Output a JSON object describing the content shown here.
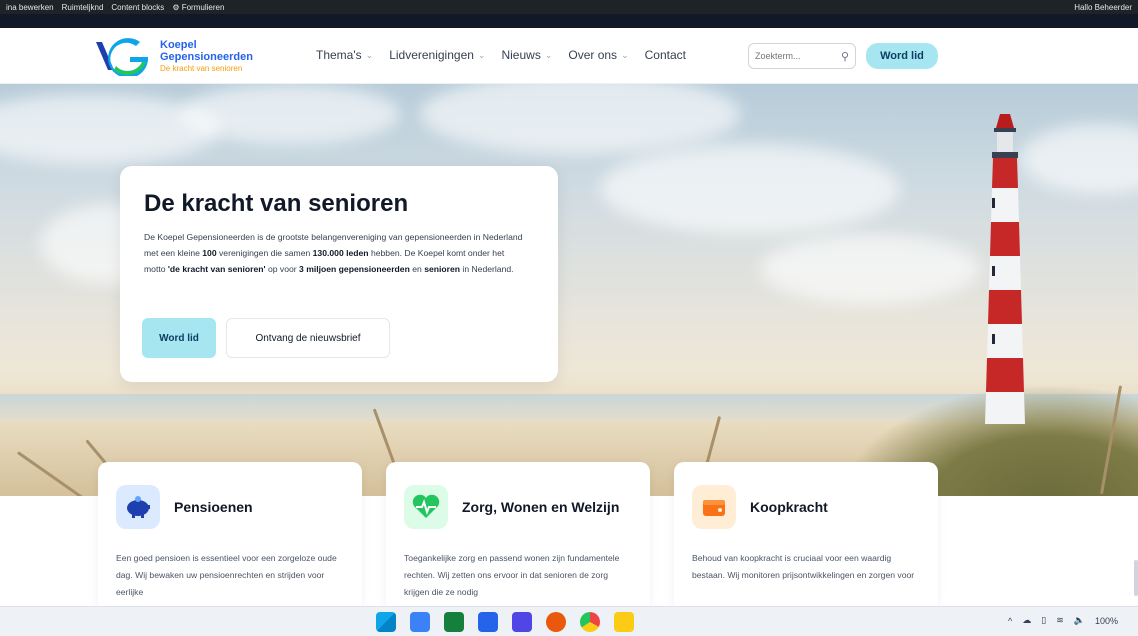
{
  "adminbar": {
    "items": [
      "ina bewerken",
      "Ruimteljknd",
      "Content blocks",
      "Formulieren"
    ],
    "right": "Hallo Beheerder"
  },
  "header": {
    "logo": {
      "line1": "Koepel",
      "line2": "Gepensioneerden",
      "tagline": "De kracht van senioren"
    },
    "nav": [
      {
        "label": "Thema's"
      },
      {
        "label": "Lidverenigingen"
      },
      {
        "label": "Nieuws"
      },
      {
        "label": "Over ons"
      },
      {
        "label": "Contact"
      }
    ],
    "search_placeholder": "Zoekterm...",
    "cta": "Word lid"
  },
  "hero": {
    "title": "De kracht van senioren",
    "text_parts": [
      "De Koepel Gepensioneerden is de grootste belangenvereniging van gepensioneerden in Nederland met een kleine ",
      "100",
      " verenigingen die samen ",
      "130.000 leden",
      " hebben. De Koepel komt onder het motto ",
      "'de kracht van senioren'",
      " op voor ",
      "3 miljoen gepensioneerden",
      " en ",
      "senioren",
      " in Nederland."
    ],
    "primary_button": "Word lid",
    "secondary_button": "Ontvang de nieuwsbrief"
  },
  "cards": [
    {
      "title": "Pensioenen",
      "text": "Een goed pensioen is essentieel voor een zorgeloze oude dag. Wij bewaken uw pensioenrechten en strijden voor eerlijke",
      "icon": "piggy-bank-icon",
      "color": "#2563eb"
    },
    {
      "title": "Zorg, Wonen en Welzijn",
      "text": "Toegankelijke zorg en passend wonen zijn fundamentele rechten. Wij zetten ons ervoor in dat senioren de zorg krijgen die ze nodig",
      "icon": "heartbeat-icon",
      "color": "#22c55e"
    },
    {
      "title": "Koopkracht",
      "text": "Behoud van koopkracht is cruciaal voor een waardig bestaan. Wij monitoren prijsontwikkelingen en zorgen voor",
      "icon": "wallet-icon",
      "color": "#f97316"
    }
  ],
  "taskbar": {
    "icons": [
      "start-icon",
      "search-icon",
      "excel-icon",
      "outlook-icon",
      "teams-icon",
      "office-icon",
      "chrome-icon",
      "explorer-icon"
    ],
    "battery": "100%"
  }
}
